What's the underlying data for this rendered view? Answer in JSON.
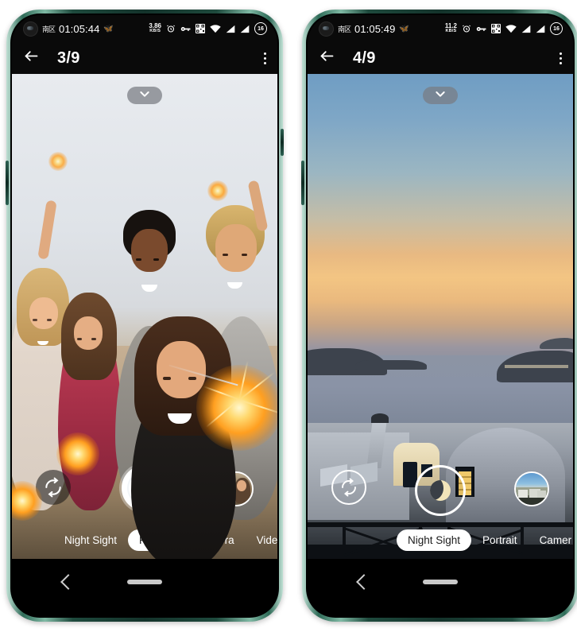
{
  "background_color": "#ffffff",
  "phones": [
    {
      "id": "left",
      "frame_color": "#1e4a3d",
      "statusbar": {
        "language_indicator": "南区",
        "time": "01:05:44",
        "weather_icon": "bird-icon",
        "network_speed_value": "3.86",
        "network_speed_unit": "KB/S",
        "icons": [
          "alarm-icon",
          "vpn-key-icon",
          "qr-code-icon",
          "wifi-icon",
          "signal-sim1-icon",
          "signal-sim2-icon"
        ],
        "battery_percent": "16"
      },
      "appbar": {
        "back_label": "←",
        "title": "3/9",
        "menu_label": "more-options"
      },
      "viewfinder": {
        "scene": "group-selfie-with-sparklers",
        "expand_chevron": "chevron-down-icon"
      },
      "controls": {
        "flip_camera_icon": "camera-flip-icon",
        "shutter_icon": "shutter-button",
        "shutter_style": "solid-white",
        "thumbnail_label": "last-photo-woman-with-dog"
      },
      "modes": [
        {
          "label": "Night Sight",
          "active": false
        },
        {
          "label": "Portrait",
          "active": true
        },
        {
          "label": "Camera",
          "active": false
        },
        {
          "label": "Video",
          "active": false
        }
      ],
      "navbar": {
        "back_icon": "nav-back-icon",
        "home_indicator": "home-pill-indicator"
      }
    },
    {
      "id": "right",
      "frame_color": "#1e4a3d",
      "statusbar": {
        "language_indicator": "南区",
        "time": "01:05:49",
        "weather_icon": "bird-icon",
        "network_speed_value": "11.2",
        "network_speed_unit": "KB/S",
        "icons": [
          "alarm-icon",
          "vpn-key-icon",
          "qr-code-icon",
          "wifi-icon",
          "signal-sim1-icon",
          "signal-sim2-icon"
        ],
        "battery_percent": "16"
      },
      "appbar": {
        "back_label": "←",
        "title": "4/9",
        "menu_label": "more-options"
      },
      "viewfinder": {
        "scene": "sunset-seascape-santorini-night",
        "expand_chevron": "chevron-down-icon"
      },
      "controls": {
        "flip_camera_icon": "camera-flip-icon",
        "shutter_icon": "night-sight-moon-icon",
        "shutter_style": "ring-with-moon",
        "thumbnail_label": "last-photo-coastal-town"
      },
      "modes": [
        {
          "label": "Night Sight",
          "active": true
        },
        {
          "label": "Portrait",
          "active": false
        },
        {
          "label": "Camer",
          "active": false
        }
      ],
      "navbar": {
        "back_icon": "nav-back-icon",
        "home_indicator": "home-pill-indicator"
      }
    }
  ]
}
